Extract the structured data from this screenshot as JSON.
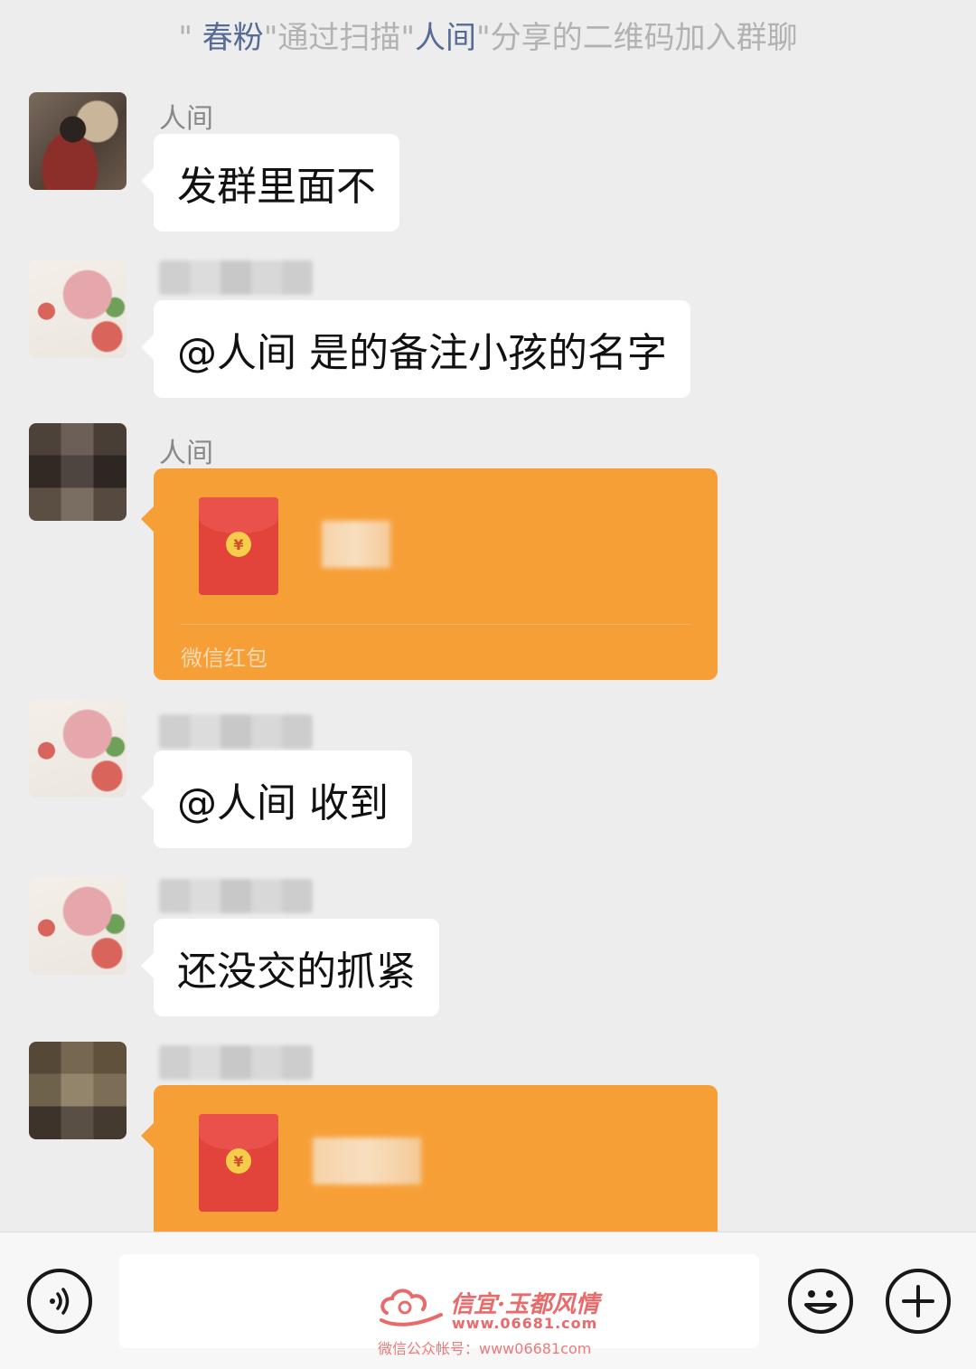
{
  "system_message": {
    "prefix": "\" ",
    "joiner_name": "春粉",
    "middle": "\"通过扫描\"",
    "sharer_name": "人间",
    "suffix": "\"分享的二维码加入群聊"
  },
  "messages": [
    {
      "sender": "人间",
      "type": "text",
      "text": "发群里面不"
    },
    {
      "sender": "",
      "type": "text",
      "text": "@人间 是的备注小孩的名字"
    },
    {
      "sender": "人间",
      "type": "red_packet",
      "footer": "微信红包"
    },
    {
      "sender": "",
      "type": "text",
      "text": "@人间 收到"
    },
    {
      "sender": "",
      "type": "text",
      "text": "还没交的抓紧"
    },
    {
      "sender": "",
      "type": "red_packet",
      "footer": ""
    }
  ],
  "input_bar": {
    "voice_icon": "voice-icon",
    "emoji_icon": "emoji-icon",
    "plus_icon": "plus-icon"
  },
  "watermark": {
    "brand": "信宜·玉都风情",
    "url": "www.06681.com",
    "account": "微信公众帐号：www06681com"
  },
  "colors": {
    "background": "#ededed",
    "bubble": "#ffffff",
    "red_packet": "#f79f37",
    "envelope": "#e2433b",
    "system_highlight": "#576b95"
  }
}
